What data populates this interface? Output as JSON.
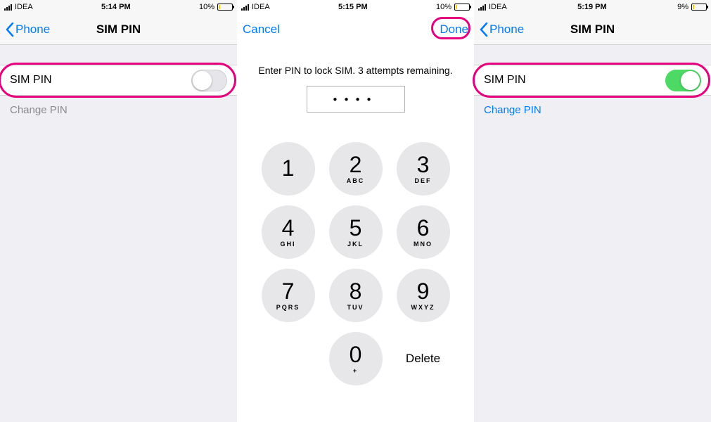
{
  "panel1": {
    "status": {
      "carrier": "IDEA",
      "time": "5:14 PM",
      "battery": "10%"
    },
    "nav": {
      "back": "Phone",
      "title": "SIM PIN"
    },
    "row": {
      "label": "SIM PIN",
      "toggle_on": false
    },
    "change_pin": "Change PIN"
  },
  "panel2": {
    "status": {
      "carrier": "IDEA",
      "time": "5:15 PM",
      "battery": "10%"
    },
    "nav": {
      "cancel": "Cancel",
      "done": "Done"
    },
    "prompt": "Enter PIN to lock SIM. 3 attempts remaining.",
    "pin_dots": "●●●●",
    "keys": [
      {
        "d": "1",
        "l": ""
      },
      {
        "d": "2",
        "l": "ABC"
      },
      {
        "d": "3",
        "l": "DEF"
      },
      {
        "d": "4",
        "l": "GHI"
      },
      {
        "d": "5",
        "l": "JKL"
      },
      {
        "d": "6",
        "l": "MNO"
      },
      {
        "d": "7",
        "l": "PQRS"
      },
      {
        "d": "8",
        "l": "TUV"
      },
      {
        "d": "9",
        "l": "WXYZ"
      }
    ],
    "zero": {
      "d": "0",
      "l": "+"
    },
    "delete": "Delete"
  },
  "panel3": {
    "status": {
      "carrier": "IDEA",
      "time": "5:19 PM",
      "battery": "9%"
    },
    "nav": {
      "back": "Phone",
      "title": "SIM PIN"
    },
    "row": {
      "label": "SIM PIN",
      "toggle_on": true
    },
    "change_pin": "Change PIN"
  }
}
